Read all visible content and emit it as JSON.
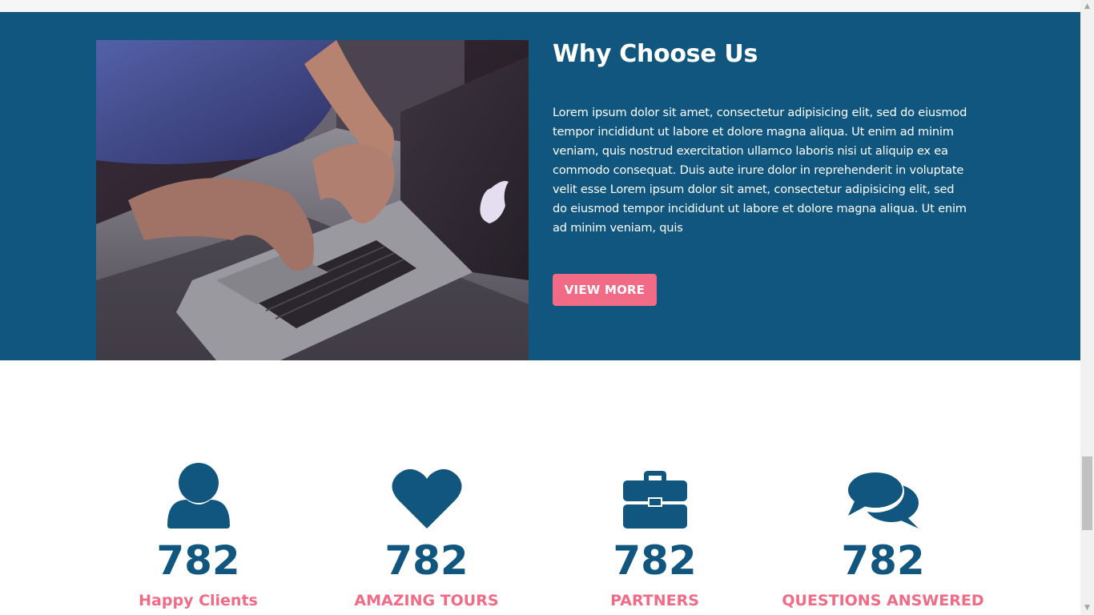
{
  "why_section": {
    "title": "Why Choose Us",
    "body": "Lorem ipsum dolor sit amet, consectetur adipisicing elit, sed do eiusmod tempor incididunt ut labore et dolore magna aliqua. Ut enim ad minim veniam, quis nostrud exercitation ullamco laboris nisi ut aliquip ex ea commodo consequat. Duis aute irure dolor in reprehenderit in voluptate velit esse Lorem ipsum dolor sit amet, consectetur adipisicing elit, sed do eiusmod tempor incididunt ut labore et dolore magna aliqua. Ut enim ad minim veniam, quis",
    "button_label": "VIEW MORE",
    "image": "laptop-typing-photo"
  },
  "stats": [
    {
      "icon": "user-icon",
      "value": "782",
      "label": "Happy Clients"
    },
    {
      "icon": "heart-icon",
      "value": "782",
      "label": "AMAZING TOURS"
    },
    {
      "icon": "briefcase-icon",
      "value": "782",
      "label": "PARTNERS"
    },
    {
      "icon": "comments-icon",
      "value": "782",
      "label": "QUESTIONS ANSWERED"
    }
  ],
  "colors": {
    "primary": "#10567e",
    "accent": "#f16b86",
    "background": "#ffffff"
  }
}
